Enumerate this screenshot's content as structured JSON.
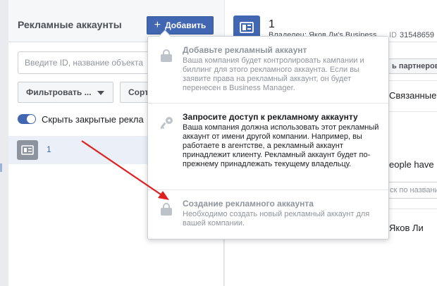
{
  "left_panel": {
    "title": "Рекламные аккаунты",
    "add_button": "Добавить",
    "search_placeholder": "Введите ID, название объекта",
    "filter_button": "Фильтровать ...",
    "sort_button": "Сорт",
    "toggle_label": "Скрыть закрытые рекла",
    "accounts": [
      {
        "name": "1"
      }
    ]
  },
  "right_panel": {
    "title": "1",
    "owner": "Владелец: Яков Ли's Business",
    "id_label": "ID",
    "id_value": "31548659",
    "partners_button": "ь партнеров",
    "linked": "Связанные",
    "people": "eople have",
    "search_placeholder": "ск по названи",
    "person": "Яков Ли"
  },
  "dropdown": {
    "items": [
      {
        "title": "Добавьте рекламный аккаунт",
        "description": "Ваша компания будет контролировать кампании и биллинг для этого рекламного аккаунта. Если вы заявите права на рекламный аккаунт, он будет перенесен в Business Manager.",
        "icon": "lock-icon",
        "enabled": false
      },
      {
        "title": "Запросите доступ к рекламному аккаунту",
        "description": "Ваша компания должна использовать этот рекламный аккаунт от имени другой компании. Например, вы работаете в агентстве, а рекламный аккаунт принадлежит клиенту. Рекламный аккаунт будет по-прежнему принадлежать текущему владельцу.",
        "icon": "key-icon",
        "enabled": true
      },
      {
        "title": "Создание рекламного аккаунта",
        "description": "Необходимо создать новый рекламный аккаунт для вашей компании.",
        "icon": "lock-icon",
        "enabled": false
      }
    ]
  },
  "colors": {
    "accent": "#4267b2",
    "annotation_arrow": "#e02020",
    "disabled_text": "#90949c"
  }
}
